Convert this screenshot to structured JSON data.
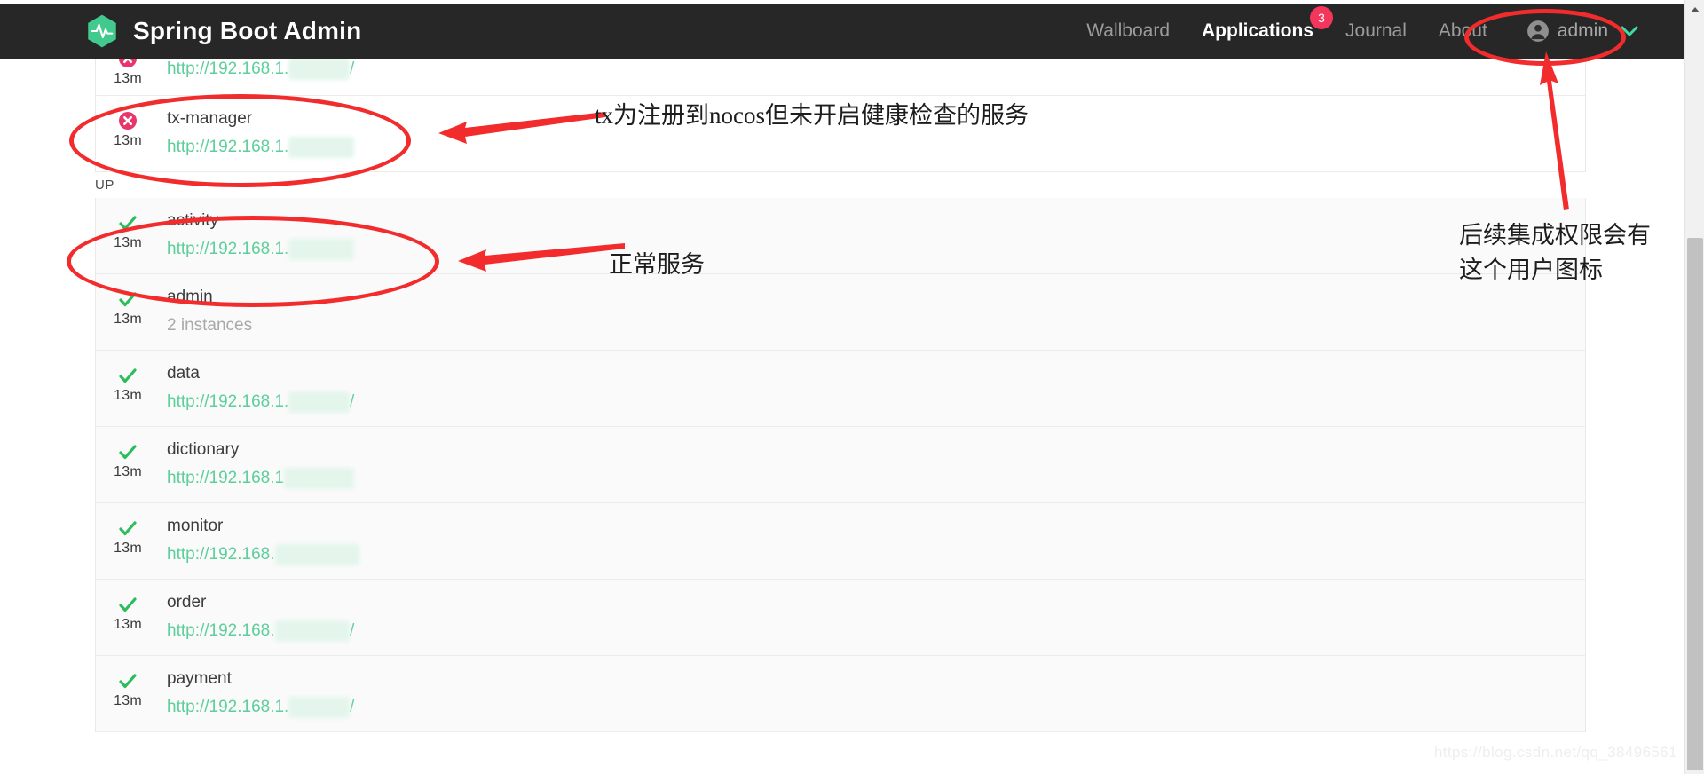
{
  "window": {
    "scrollbar": {
      "up_arrow_icon": "triangle-up-icon"
    }
  },
  "header": {
    "logo_icon": "spring-boot-admin-heartbeat-logo",
    "title": "Spring Boot Admin",
    "nav": [
      {
        "label": "Wallboard",
        "active": false,
        "badge": ""
      },
      {
        "label": "Applications",
        "active": true,
        "badge": "3"
      },
      {
        "label": "Journal",
        "active": false,
        "badge": ""
      },
      {
        "label": "About",
        "active": false,
        "badge": ""
      }
    ],
    "user": {
      "avatar_icon": "user-circle-icon",
      "name": "admin",
      "chevron_icon": "chevron-down-icon"
    }
  },
  "colors": {
    "header_bg": "#272727",
    "brand_green": "#42c98e",
    "badge_red": "#f5365c",
    "status_up": "#2bbd5b",
    "status_down": "#e8366b",
    "url_green": "#5ccf9a",
    "annotation_red": "#f22c2c"
  },
  "main": {
    "groups": [
      {
        "label": "",
        "shaded": false,
        "rows": [
          {
            "name": "",
            "status_icon": "status-down-icon",
            "status": "DOWN",
            "age": "13m",
            "url_prefix": "http://192.168.1.",
            "url_masked": "88:8888",
            "url_suffix": "/",
            "partial": true
          }
        ]
      },
      {
        "label": "",
        "shaded": false,
        "rows": [
          {
            "name": "tx-manager",
            "status_icon": "status-down-icon",
            "status": "DOWN",
            "age": "13m",
            "url_prefix": "http://192.168.1.",
            "url_masked": "88:8888/",
            "url_suffix": "",
            "partial": false
          }
        ]
      },
      {
        "label": "UP",
        "shaded": true,
        "rows": [
          {
            "name": "activity",
            "status_icon": "status-up-icon",
            "status": "UP",
            "age": "13m",
            "url_prefix": "http://192.168.1.",
            "url_masked": "88:8888/",
            "url_suffix": "",
            "partial": false
          },
          {
            "name": "admin",
            "status_icon": "status-up-icon",
            "status": "UP",
            "age": "13m",
            "instances": "2 instances",
            "partial": false
          },
          {
            "name": "data",
            "status_icon": "status-up-icon",
            "status": "UP",
            "age": "13m",
            "url_prefix": "http://192.168.1.",
            "url_masked": "88:8888",
            "url_suffix": "/",
            "partial": false
          },
          {
            "name": "dictionary",
            "status_icon": "status-up-icon",
            "status": "UP",
            "age": "13m",
            "url_prefix": "http://192.168.1",
            "url_masked": ".88:8888/",
            "url_suffix": "",
            "partial": false
          },
          {
            "name": "monitor",
            "status_icon": "status-up-icon",
            "status": "UP",
            "age": "13m",
            "url_prefix": "http://192.168.",
            "url_masked": "1.88:888 8/",
            "url_suffix": "",
            "partial": false
          },
          {
            "name": "order",
            "status_icon": "status-up-icon",
            "status": "UP",
            "age": "13m",
            "url_prefix": "http://192.168.",
            "url_masked": "1.88:8888",
            "url_suffix": "/",
            "partial": false
          },
          {
            "name": "payment",
            "status_icon": "status-up-icon",
            "status": "UP",
            "age": "13m",
            "url_prefix": "http://192.168.1.",
            "url_masked": "88:8888",
            "url_suffix": "/",
            "partial": false
          }
        ]
      }
    ]
  },
  "annotations": {
    "note_tx": "tx为注册到nocos但未开启健康检查的服务",
    "note_normal": "正常服务",
    "note_user_line1": "后续集成权限会有",
    "note_user_line2": "这个用户图标"
  },
  "watermark": "https://blog.csdn.net/qq_38496561"
}
